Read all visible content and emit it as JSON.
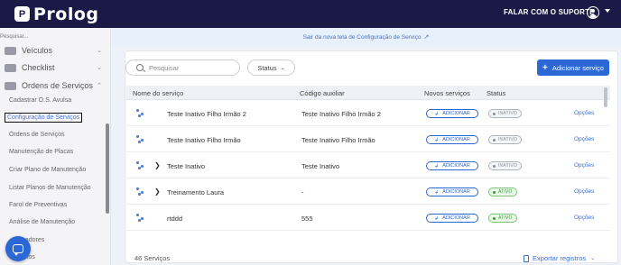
{
  "app": {
    "brand": "Prolog",
    "brand_initial": "P",
    "support_label": "FALAR COM O SUPORTE"
  },
  "sidebar": {
    "search_placeholder": "Pesquisar...",
    "top_items": [
      {
        "label": "Veículos",
        "icon": "truck-icon"
      },
      {
        "label": "Checklist",
        "icon": "checklist-icon"
      },
      {
        "label": "Ordens de Serviços",
        "icon": "wrench-icon"
      }
    ],
    "items": [
      "Cadastrar O.S. Avulsa",
      "Configuração de Serviços",
      "Ordens de Serviços",
      "Manutenção de Placas",
      "Criar Plano de Manutenção",
      "Listar Planos de Manutenção",
      "Farol de Preventivas",
      "Análise de Manutenção",
      "...adores",
      "...itos"
    ],
    "active_index": 1
  },
  "banner": {
    "text": "Sair da nova tela de Configuração de Serviço"
  },
  "toolbar": {
    "search_placeholder": "Pesquisar",
    "status_filter": "Status",
    "add_button": "Adicionar serviço"
  },
  "table": {
    "headers": [
      "Nome do serviço",
      "Código auxiliar",
      "Novos serviços",
      "Status"
    ],
    "rows": [
      {
        "name": "Teste Inativo Filho Irmão 2",
        "code": "Teste Inativo Filho Irmão 2",
        "action": "ADICIONAR",
        "status": "INATIVO",
        "options": "Opções",
        "expandable": false
      },
      {
        "name": "Teste Inativo Filho Irmão",
        "code": "Teste Inativo Filho Irmão",
        "action": "ADICIONAR",
        "status": "INATIVO",
        "options": "Opções",
        "expandable": false
      },
      {
        "name": "Teste Inativo",
        "code": "Teste Inativo",
        "action": "ADICIONAR",
        "status": "INATIVO",
        "options": "Opções",
        "expandable": true
      },
      {
        "name": "Treinamento Laura",
        "code": "-",
        "action": "ADICIONAR",
        "status": "ATIVO",
        "options": "Opções",
        "expandable": true
      },
      {
        "name": "rtddd",
        "code": "555",
        "action": "ADICIONAR",
        "status": "ATIVO",
        "options": "Opções",
        "expandable": false
      }
    ]
  },
  "footer": {
    "count": "46 Serviços",
    "export": "Exportar registros"
  },
  "colors": {
    "topbar": "#1b1a47",
    "primary": "#2c67d6",
    "active_green": "#3b9a39",
    "inactive_gray": "#8a8e96"
  }
}
